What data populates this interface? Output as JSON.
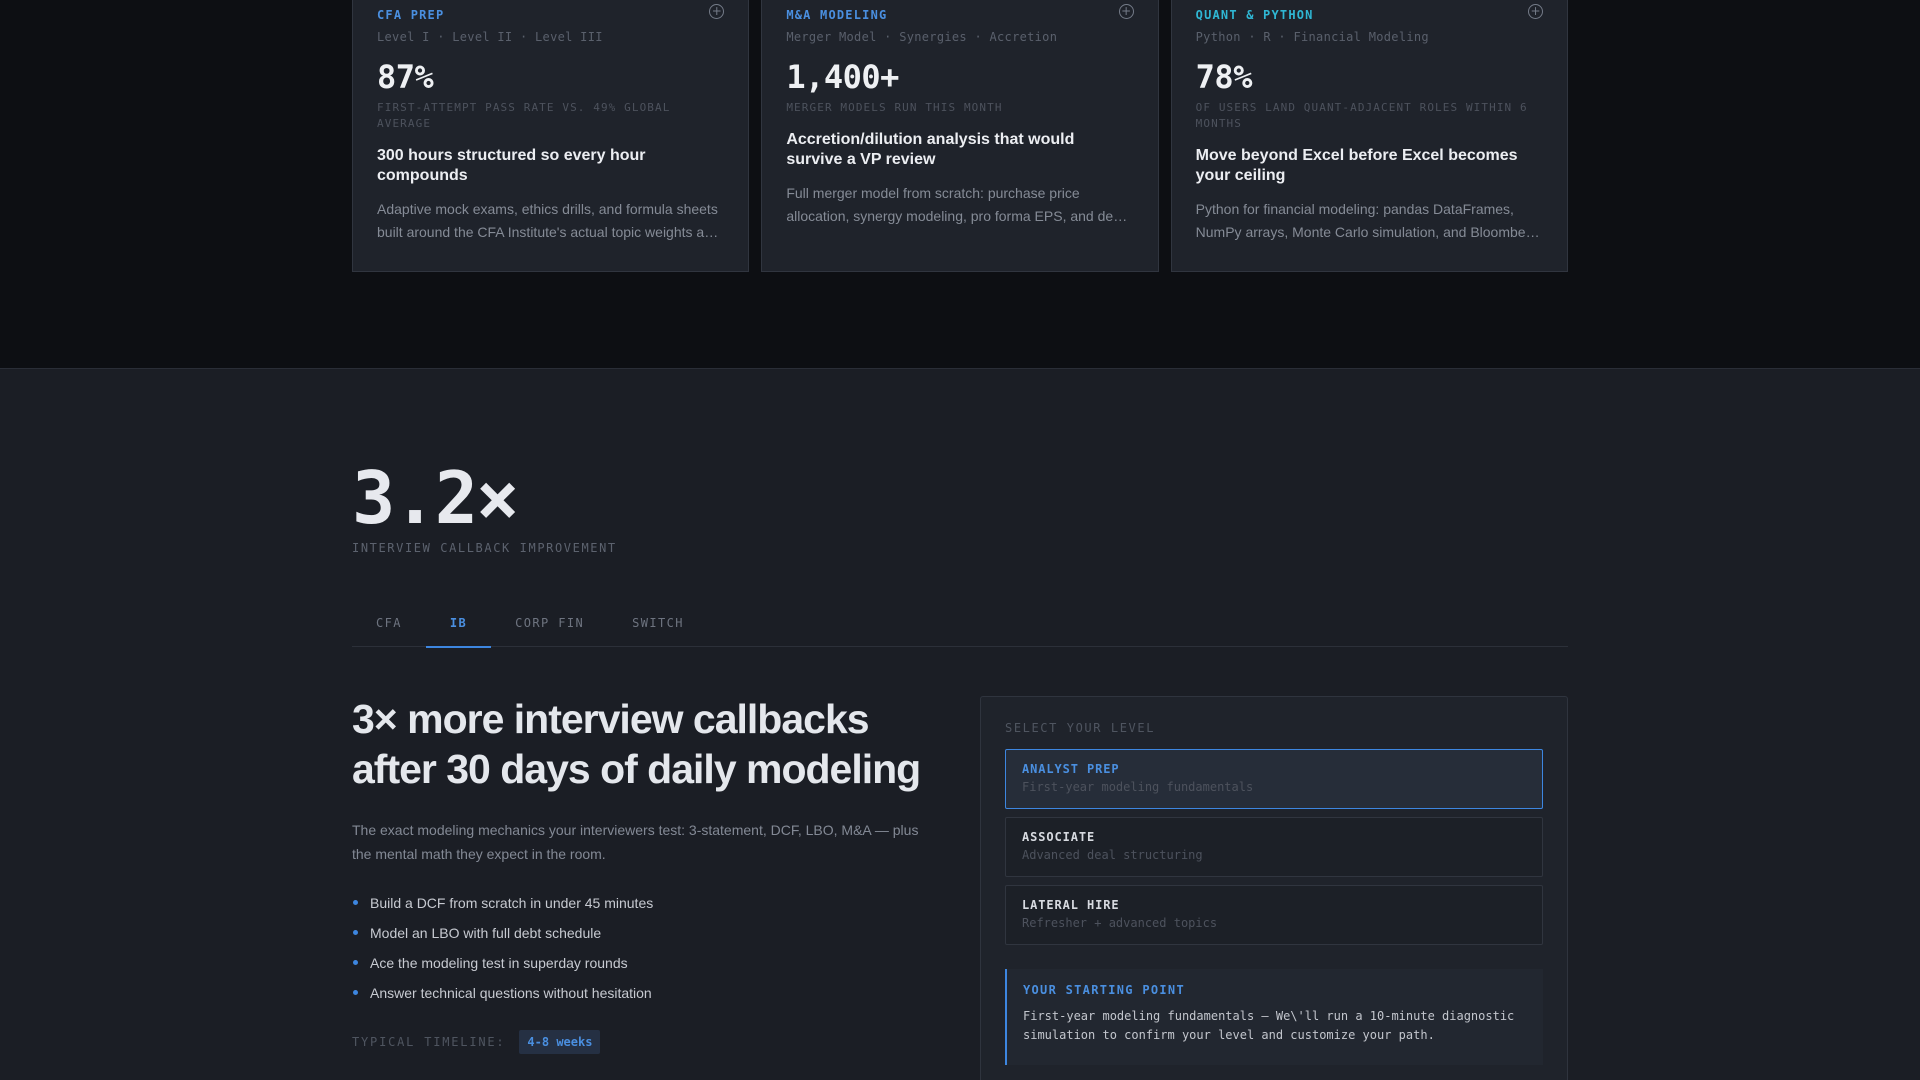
{
  "cards": [
    {
      "tag": "CFA PREP",
      "sub": "Level I · Level II · Level III",
      "stat": "87%",
      "stat_label": "FIRST-ATTEMPT PASS RATE VS. 49% GLOBAL AVERAGE",
      "title": "300 hours structured so every hour compounds",
      "desc": "Adaptive mock exams, ethics drills, and formula sheets built around the CFA Institute's actual topic weights and exam blueprint.",
      "accent": "#4a8fe0"
    },
    {
      "tag": "M&A MODELING",
      "sub": "Merger Model · Synergies · Accretion",
      "stat": "1,400+",
      "stat_label": "MERGER MODELS RUN THIS MONTH",
      "title": "Accretion/dilution analysis that would survive a VP review",
      "desc": "Full merger model from scratch: purchase price allocation, synergy modeling, pro forma EPS, and deal structuring.",
      "accent": "#4a8fe0"
    },
    {
      "tag": "QUANT & PYTHON",
      "sub": "Python · R · Financial Modeling",
      "stat": "78%",
      "stat_label": "OF USERS LAND QUANT-ADJACENT ROLES WITHIN 6 MONTHS",
      "title": "Move beyond Excel before Excel becomes your ceiling",
      "desc": "Python for financial modeling: pandas DataFrames, NumPy arrays, Monte Carlo simulation, and Bloomberg API integration.",
      "accent": "#2fb7d4"
    }
  ],
  "metric": {
    "value": "3.2×",
    "label": "INTERVIEW CALLBACK IMPROVEMENT"
  },
  "tabs": [
    "CFA",
    "IB",
    "CORP FIN",
    "SWITCH"
  ],
  "active_tab": "IB",
  "content": {
    "headline": "3× more interview callbacks after 30 days of daily modeling",
    "lead": "The exact modeling mechanics your interviewers test: 3-statement, DCF, LBO, M&A — plus the mental math they expect in the room.",
    "bullets": [
      "Build a DCF from scratch in under 45 minutes",
      "Model an LBO with full debt schedule",
      "Ace the modeling test in superday rounds",
      "Answer technical questions without hesitation"
    ],
    "timeline_label": "TYPICAL TIMELINE:",
    "timeline_value": "4-8 weeks"
  },
  "panel": {
    "label": "SELECT YOUR LEVEL",
    "levels": [
      {
        "name": "ANALYST PREP",
        "desc": "First-year modeling fundamentals",
        "selected": true
      },
      {
        "name": "ASSOCIATE",
        "desc": "Advanced deal structuring",
        "selected": false
      },
      {
        "name": "LATERAL HIRE",
        "desc": "Refresher + advanced topics",
        "selected": false
      }
    ],
    "starting_title": "YOUR STARTING POINT",
    "starting_text": "First-year modeling fundamentals — We\\'ll run a 10-minute diagnostic simulation to confirm your level and customize your path."
  },
  "icons": {
    "card_add": "plus-circle-icon",
    "bullet": "dot-icon"
  }
}
